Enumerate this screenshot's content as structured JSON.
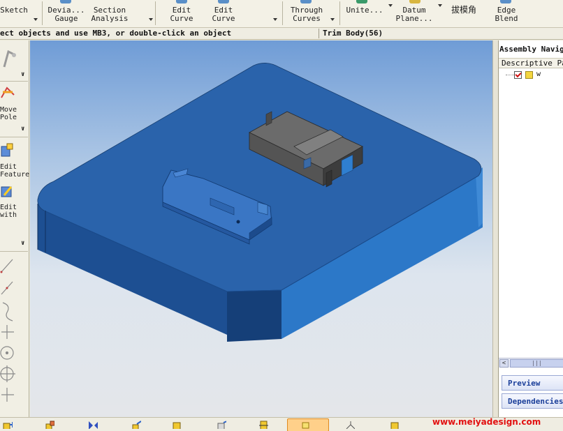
{
  "toolbar": {
    "sketch_label": "Sketch",
    "deviation_gauge_l1": "Devia...",
    "deviation_gauge_l2": "Gauge",
    "section_analysis_l1": "Section",
    "section_analysis_l2": "Analysis",
    "edit_curve_a_l1": "Edit",
    "edit_curve_a_l2": "Curve",
    "edit_curve_b_l1": "Edit",
    "edit_curve_b_l2": "Curve",
    "through_curves_l1": "Through",
    "through_curves_l2": "Curves",
    "unite_label": "Unite...",
    "datum_plane_l1": "Datum",
    "datum_plane_l2": "Plane...",
    "draft_angle_label": "拔模角",
    "edge_blend_l1": "Edge",
    "edge_blend_l2": "Blend"
  },
  "status": {
    "cue_text": "ect objects and use MB3, or double-click an object",
    "context_text": "Trim Body(56)"
  },
  "leftbar": {
    "move_pole_l1": "Move",
    "move_pole_l2": "Pole",
    "edit_feature_l1": "Edit",
    "edit_feature_l2": "Feature",
    "edit_with_l1": "Edit",
    "edit_with_l2": "with"
  },
  "navigator": {
    "title": "Assembly Navigator",
    "column_header": "Descriptive Part Name",
    "root_part_name": "w",
    "thumb_grip": "|||",
    "preview_label": "Preview",
    "dependencies_label": "Dependencies"
  },
  "watermark": "www.meiyadesign.com",
  "colors": {
    "model_top": "#2b65ad",
    "model_side": "#1f559c",
    "model_front": "#2d78c8",
    "accent_red": "#e21010"
  },
  "icons": [
    "sketch-icon",
    "deviation-gauge-icon",
    "section-analysis-icon",
    "edit-curve-icon",
    "through-curves-icon",
    "unite-icon",
    "datum-plane-icon",
    "edge-blend-icon",
    "move-pole-icon",
    "edit-feature-icon",
    "line-icon",
    "arc-icon",
    "circle-icon",
    "point-icon"
  ]
}
